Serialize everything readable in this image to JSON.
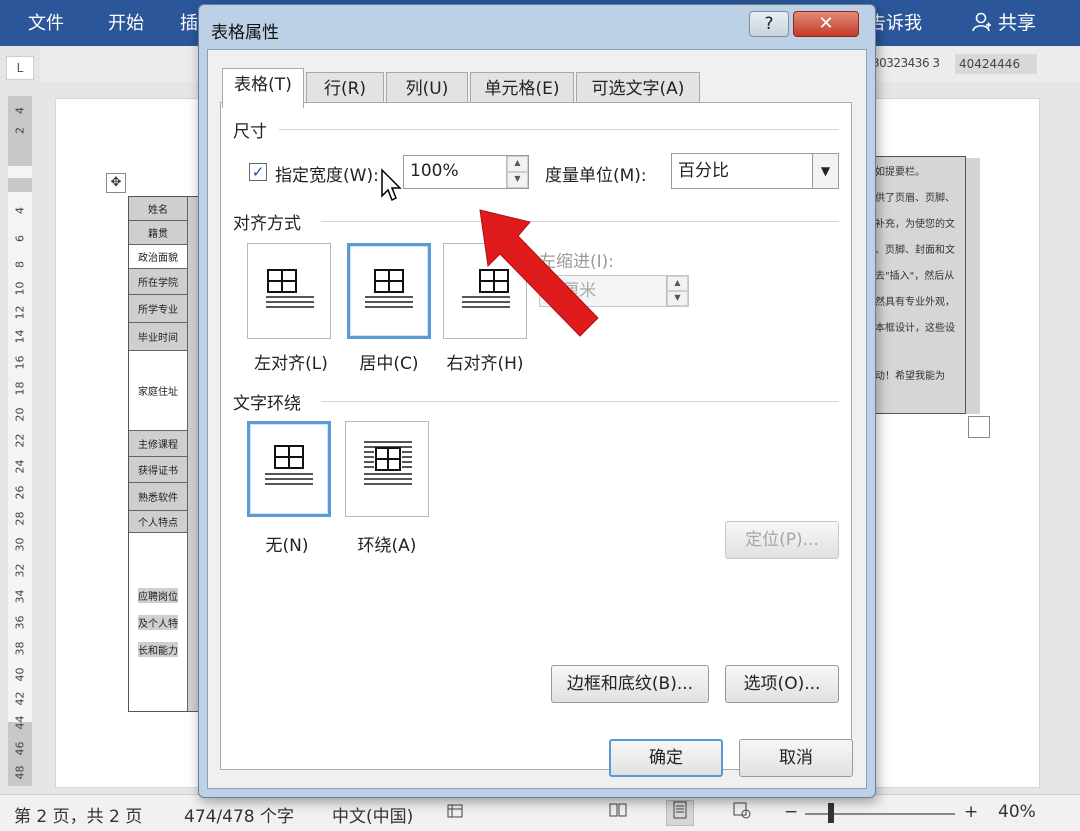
{
  "ribbon": {
    "tabs": [
      "文件",
      "开始",
      "插"
    ],
    "tell_me": "告诉我",
    "share": "共享"
  },
  "ruler": {
    "corner": "L",
    "numbers_text": "30323436 3",
    "tail_text": "40424446",
    "vertical": [
      "4",
      "2",
      "4",
      "6",
      "8",
      "10",
      "12",
      "14",
      "16",
      "18",
      "20",
      "22",
      "24",
      "26",
      "28",
      "30",
      "32",
      "34",
      "36",
      "38",
      "40",
      "42",
      "44",
      "46",
      "48"
    ]
  },
  "document": {
    "row_labels": [
      "姓名",
      "籍贯",
      "政治面貌",
      "所在学院",
      "所学专业",
      "毕业时间",
      "家庭住址",
      "主修课程",
      "获得证书",
      "熟悉软件",
      "个人特点",
      "应聘岗位",
      "及个人特",
      "长和能力"
    ],
    "right_lines": [
      "如提要栏。",
      "供了页眉、页脚、",
      "补充，为使您的文",
      "、页脚、封面和文",
      "去\"插入\"，然后从",
      "然具有专业外观，",
      "本框设计，这些设",
      "动！希望我能为"
    ]
  },
  "status": {
    "page": "第 2 页，共 2 页",
    "words": "474/478 个字",
    "lang": "中文(中国)",
    "zoom_minus": "−",
    "zoom_plus": "+",
    "zoom": "40%"
  },
  "dialog": {
    "title": "表格属性",
    "help": "?",
    "close": "✕",
    "tabs": [
      "表格(T)",
      "行(R)",
      "列(U)",
      "单元格(E)",
      "可选文字(A)"
    ],
    "size_section": "尺寸",
    "specify_width_label": "指定宽度(W):",
    "specify_width_checked": true,
    "width_value": "100%",
    "measure_label": "度量单位(M):",
    "measure_value": "百分比",
    "align_section": "对齐方式",
    "align_options": [
      "左对齐(L)",
      "居中(C)",
      "右对齐(H)"
    ],
    "align_selected": "居中(C)",
    "indent_label": "左缩进(I):",
    "indent_value": "0 厘米",
    "wrap_section": "文字环绕",
    "wrap_options": [
      "无(N)",
      "环绕(A)"
    ],
    "wrap_selected": "无(N)",
    "position_button": "定位(P)...",
    "borders_button": "边框和底纹(B)...",
    "options_button": "选项(O)...",
    "ok_button": "确定",
    "cancel_button": "取消"
  }
}
